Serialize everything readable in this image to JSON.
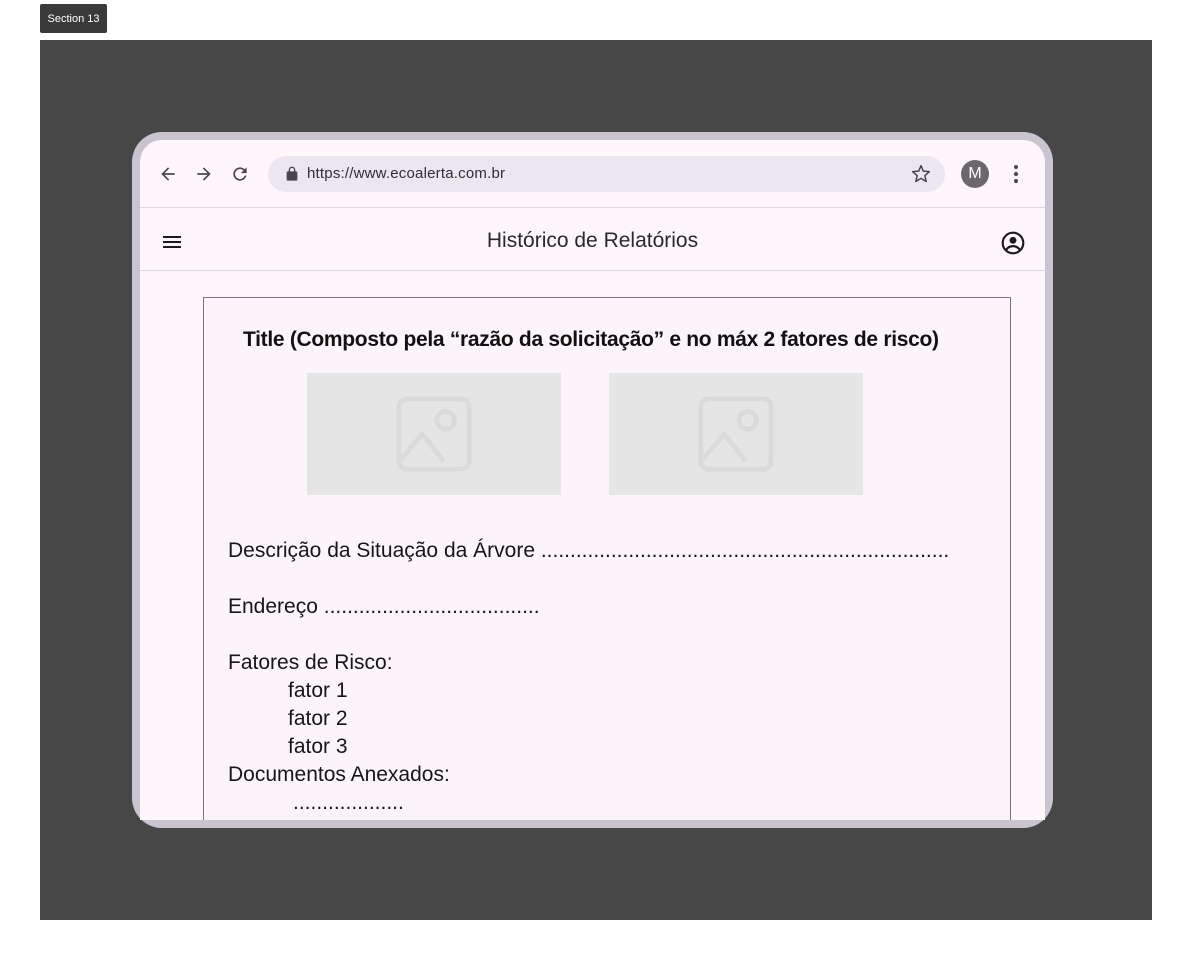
{
  "section": {
    "label": "Section 13"
  },
  "browser": {
    "url": "https://www.ecoalerta.com.br",
    "profile_initial": "M",
    "icons": {
      "back": "arrow-left-icon",
      "forward": "arrow-right-icon",
      "reload": "refresh-icon",
      "lock": "lock-icon",
      "bookmark": "star-icon",
      "menu": "more-vert-icon"
    }
  },
  "app_bar": {
    "title": "Histórico de Relatórios",
    "icons": {
      "menu": "hamburger-menu-icon",
      "account": "account-circle-icon"
    }
  },
  "report": {
    "title": "Title (Composto pela “razão da solicitação” e  no máx 2 fatores de risco)",
    "images": [
      "image-placeholder-icon",
      "image-placeholder-icon"
    ],
    "description_line": "Descrição da Situação da Árvore ......................................................................",
    "address_line": "Endereço .....................................",
    "risk_factors_label": "Fatores de Risco:",
    "risk_factors": [
      "fator 1",
      "fator 2",
      "fator 3"
    ],
    "documents_label": "Documentos Anexados:",
    "documents_placeholder": "..................."
  },
  "colors": {
    "canvas": "#474747",
    "device_frame": "#cac4d0",
    "screen_bg": "#fdf7fc",
    "url_bar_bg": "#ece6f0",
    "placeholder_bg": "#e5e5e5"
  }
}
